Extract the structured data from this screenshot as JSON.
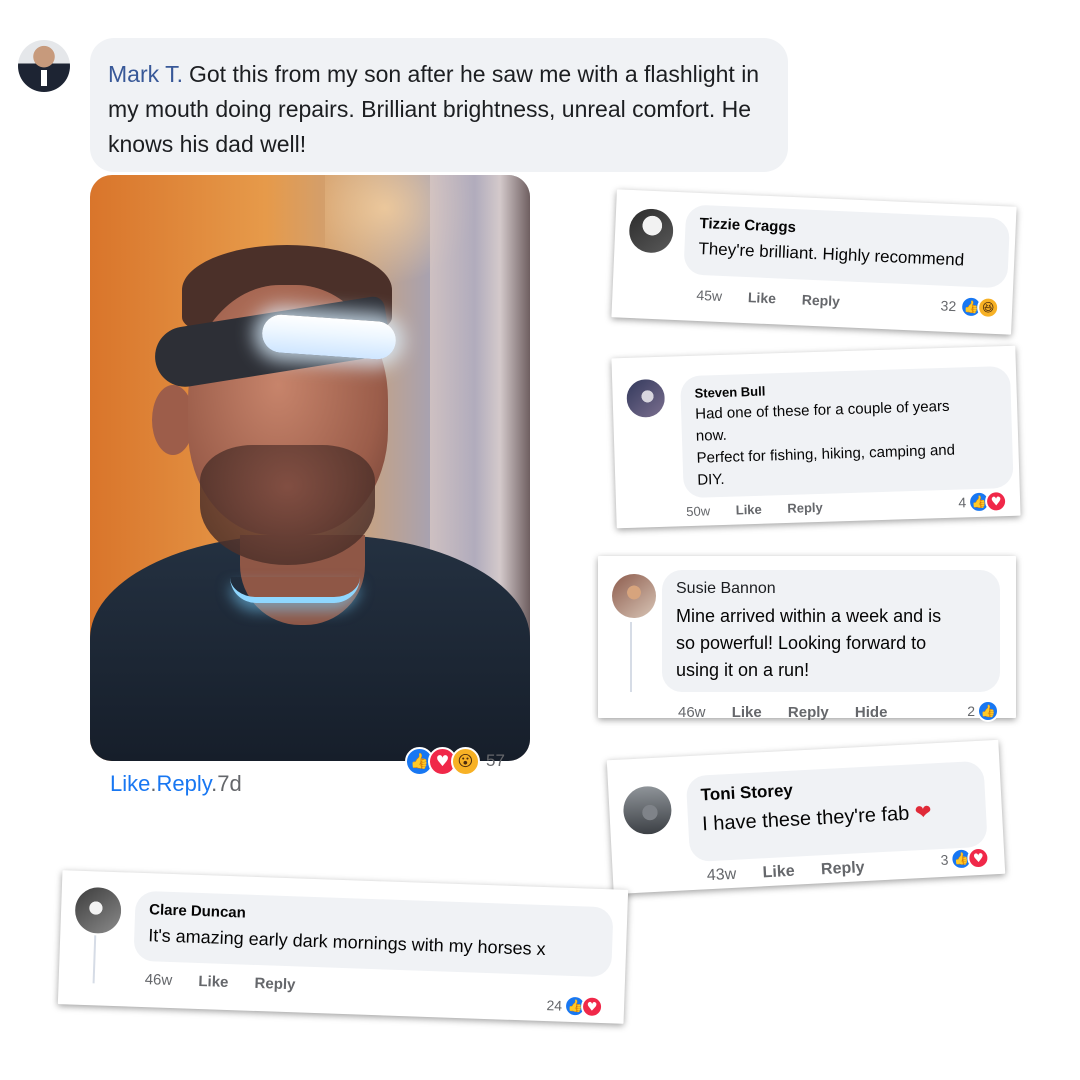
{
  "main_comment": {
    "author": "Mark T.",
    "text": "Got this from my son after he saw me with a flashlight in my mouth doing repairs. Brilliant brightness, unreal comfort. He knows his dad well!",
    "photo_alt": "Man wearing an LED headlamp band",
    "reactions": {
      "icons": [
        "like",
        "love",
        "wow"
      ],
      "count": "57"
    },
    "actions": {
      "like": "Like",
      "separator1": ".",
      "reply": "Reply",
      "separator2": ".",
      "age": "7d"
    }
  },
  "comments": [
    {
      "id": "tizzie",
      "author": "Tizzie Craggs",
      "text": "They're brilliant. Highly recommend",
      "age": "45w",
      "like_label": "Like",
      "reply_label": "Reply",
      "reaction_count": "32",
      "reaction_icons": [
        "like",
        "haha"
      ]
    },
    {
      "id": "steven",
      "author": "Steven Bull",
      "text_lines": [
        "Had one of these for a couple of years",
        "now.",
        "Perfect for fishing, hiking, camping and",
        "DIY."
      ],
      "age": "50w",
      "like_label": "Like",
      "reply_label": "Reply",
      "reaction_count": "4",
      "reaction_icons": [
        "like",
        "love"
      ]
    },
    {
      "id": "susie",
      "author": "Susie Bannon",
      "text_lines": [
        "Mine arrived within a week and is",
        "so powerful! Looking forward to",
        "using it on a run!"
      ],
      "age": "46w",
      "like_label": "Like",
      "reply_label": "Reply",
      "hide_label": "Hide",
      "reaction_count": "2",
      "reaction_icons": [
        "like"
      ]
    },
    {
      "id": "toni",
      "author": "Toni Storey",
      "text": "I have these they're fab",
      "emoji": "❤",
      "age": "43w",
      "like_label": "Like",
      "reply_label": "Reply",
      "reaction_count": "3",
      "reaction_icons": [
        "like",
        "love"
      ]
    },
    {
      "id": "clare",
      "author": "Clare Duncan",
      "text": "It's amazing early dark mornings with my horses x",
      "age": "46w",
      "like_label": "Like",
      "reply_label": "Reply",
      "reaction_count": "24",
      "reaction_icons": [
        "like",
        "love"
      ]
    }
  ],
  "icons": {
    "like": "👍",
    "love": "♥",
    "wow": "😮",
    "haha": "😆"
  },
  "colors": {
    "author_link": "#385898",
    "action_link": "#1877f2",
    "bubble": "#f0f2f5",
    "like": "#1877f2",
    "love": "#f02849",
    "wow_haha": "#f7b125"
  }
}
